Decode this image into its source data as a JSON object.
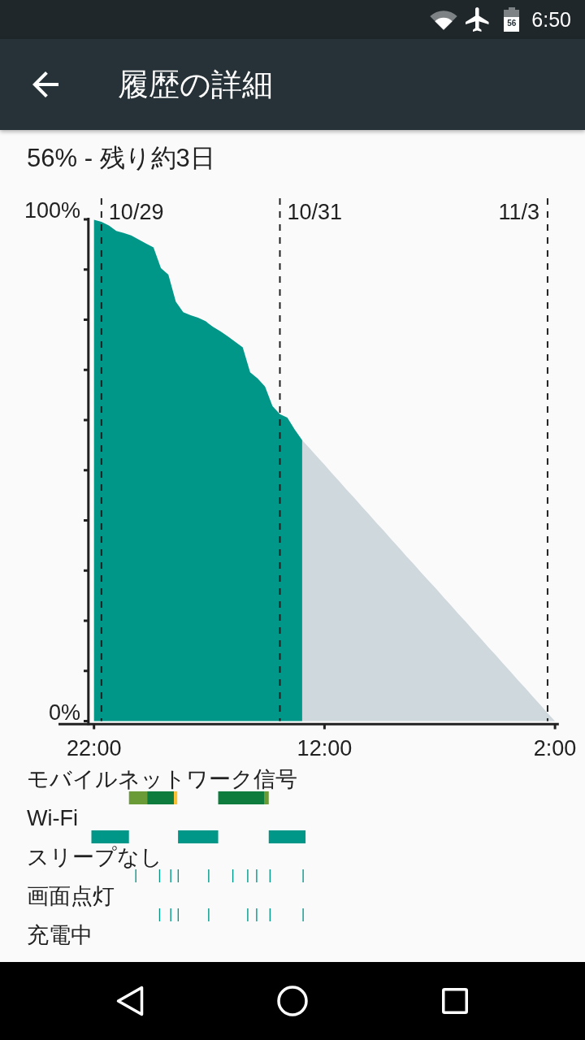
{
  "status_bar": {
    "battery_text": "56",
    "time": "6:50"
  },
  "app_bar": {
    "title": "履歴の詳細"
  },
  "summary": "56% - 残り約3日",
  "chart": {
    "chart_data": {
      "type": "area",
      "categories": [
        "22:00",
        null,
        null,
        null,
        null,
        null,
        null,
        null,
        null,
        null,
        null,
        null,
        null,
        null,
        null,
        null,
        null,
        null,
        null,
        null,
        null,
        null,
        null,
        null,
        null,
        null,
        null,
        null,
        null,
        null,
        null,
        "12:00",
        null,
        null,
        null,
        null,
        null,
        null,
        null,
        null,
        null,
        null,
        null,
        null,
        null,
        null,
        null,
        null,
        null,
        null,
        null,
        null,
        null,
        null,
        null,
        null,
        null,
        null,
        null,
        null,
        null,
        null,
        "2:00"
      ],
      "series": [
        {
          "color": "#009688",
          "values": [
            99.9,
            99.5,
            98.8,
            97.7,
            97.3,
            96.8,
            96.0,
            95.2,
            94.4,
            90.3,
            89.0,
            83.6,
            81.5,
            80.9,
            80.4,
            79.7,
            78.6,
            77.7,
            76.7,
            75.6,
            74.5,
            69.5,
            68.3,
            66.7,
            62.8,
            61.2,
            60.5,
            58.1,
            56.0,
            null,
            null,
            null,
            null,
            null,
            null,
            null,
            null,
            null,
            null,
            null,
            null,
            null,
            null,
            null,
            null,
            null,
            null,
            null,
            null,
            null,
            null,
            null,
            null,
            null,
            null,
            null,
            null,
            null,
            null,
            null,
            null,
            null,
            null
          ]
        },
        {
          "color": "#cfd8dc",
          "values": [
            null,
            null,
            null,
            null,
            null,
            null,
            null,
            null,
            null,
            null,
            null,
            null,
            null,
            null,
            null,
            null,
            null,
            null,
            null,
            null,
            null,
            null,
            null,
            null,
            null,
            null,
            null,
            null,
            56.0,
            54.4,
            52.7,
            51.1,
            49.4,
            47.8,
            46.1,
            44.5,
            42.8,
            41.2,
            39.5,
            37.9,
            36.2,
            34.6,
            32.9,
            31.3,
            29.6,
            28.0,
            26.4,
            24.7,
            23.1,
            21.4,
            19.8,
            18.1,
            16.5,
            14.8,
            13.2,
            11.5,
            9.9,
            8.2,
            6.6,
            4.9,
            3.3,
            1.6,
            0
          ]
        }
      ],
      "ylim": [
        0,
        100
      ],
      "yticks": [
        {
          "value": 0,
          "label": "0%"
        },
        {
          "value": 100,
          "label": "100%"
        }
      ],
      "grid": true,
      "annotations": [
        "10/29",
        "10/31",
        "11/3"
      ]
    }
  },
  "tracks": [
    {
      "label": "モバイルネットワーク信号",
      "segments": [
        {
          "color": "#6b9b37"
        },
        {
          "color": "#0e7c3d"
        },
        {
          "color": "#fbc02d"
        },
        {
          "color": "#0e7c3d"
        },
        {
          "color": "#6b9b37"
        }
      ]
    },
    {
      "label": "Wi-Fi"
    },
    {
      "label": "スリープなし"
    },
    {
      "label": "画面点灯"
    },
    {
      "label": "充電中"
    }
  ]
}
